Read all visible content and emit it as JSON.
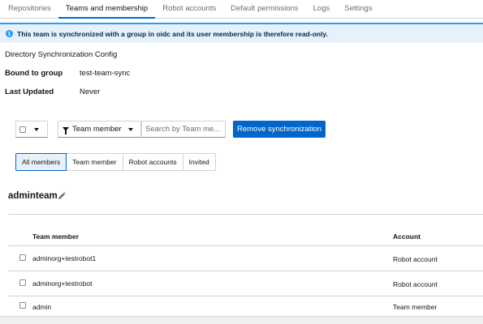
{
  "tabs": [
    {
      "label": "Repositories"
    },
    {
      "label": "Teams and membership",
      "active": true
    },
    {
      "label": "Robot accounts"
    },
    {
      "label": "Default permissions"
    },
    {
      "label": "Logs"
    },
    {
      "label": "Settings"
    }
  ],
  "alert": {
    "icon": "info-icon",
    "text": "This team is synchronized with a group in oidc and its user membership is therefore read-only."
  },
  "sync_config": {
    "heading": "Directory Synchronization Config",
    "bound_label": "Bound to group",
    "bound_value": "test-team-sync",
    "updated_label": "Last Updated",
    "updated_value": "Never"
  },
  "toolbar": {
    "filter_label": "Team member",
    "search_placeholder": "Search by Team me...",
    "remove_button": "Remove synchronization"
  },
  "member_filters": [
    {
      "label": "All members",
      "active": true
    },
    {
      "label": "Team member"
    },
    {
      "label": "Robot accounts"
    },
    {
      "label": "Invited"
    }
  ],
  "team": {
    "name": "adminteam",
    "edit_icon": "pencil-icon"
  },
  "table": {
    "headers": {
      "member": "Team member",
      "account": "Account"
    },
    "rows": [
      {
        "member": "adminorg+testrobot1",
        "account": "Robot account"
      },
      {
        "member": "adminorg+testrobot",
        "account": "Robot account"
      },
      {
        "member": "admin",
        "account": "Team member"
      }
    ]
  },
  "colors": {
    "primary": "#0066cc",
    "alert_bg": "#e7f1fa",
    "alert_accent": "#2b9af3"
  }
}
